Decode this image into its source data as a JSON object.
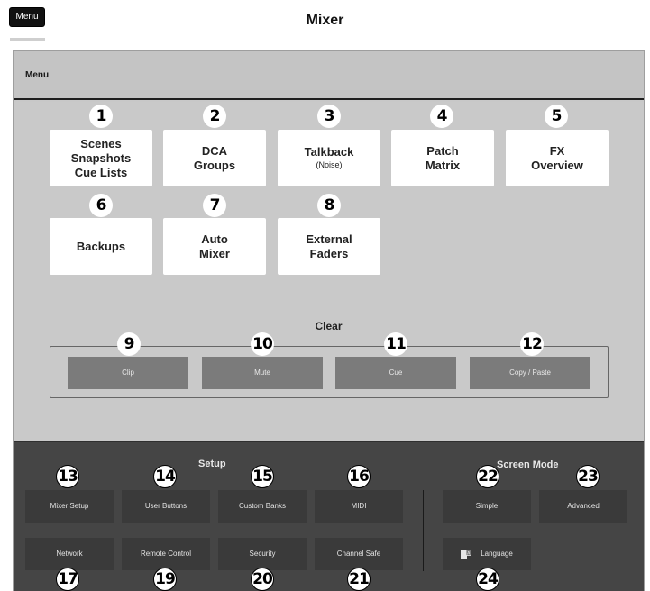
{
  "header": {
    "menu_badge": "Menu",
    "title": "Mixer"
  },
  "window": {
    "title": "Menu"
  },
  "menu_tiles": [
    {
      "num": "1",
      "lines": [
        "Scenes",
        "Snapshots",
        "Cue Lists"
      ],
      "sub": ""
    },
    {
      "num": "2",
      "lines": [
        "DCA",
        "Groups"
      ],
      "sub": ""
    },
    {
      "num": "3",
      "lines": [
        "Talkback"
      ],
      "sub": "(Noise)"
    },
    {
      "num": "4",
      "lines": [
        "Patch",
        "Matrix"
      ],
      "sub": ""
    },
    {
      "num": "5",
      "lines": [
        "FX",
        "Overview"
      ],
      "sub": ""
    },
    {
      "num": "6",
      "lines": [
        "Backups"
      ],
      "sub": ""
    },
    {
      "num": "7",
      "lines": [
        "Auto",
        "Mixer"
      ],
      "sub": ""
    },
    {
      "num": "8",
      "lines": [
        "External",
        "Faders"
      ],
      "sub": ""
    }
  ],
  "clear": {
    "label": "Clear",
    "buttons": [
      {
        "num": "9",
        "label": "Clip"
      },
      {
        "num": "10",
        "label": "Mute"
      },
      {
        "num": "11",
        "label": "Cue"
      },
      {
        "num": "12",
        "label": "Copy / Paste"
      }
    ]
  },
  "setup": {
    "label": "Setup",
    "buttons": [
      {
        "num": "13",
        "label": "Mixer Setup"
      },
      {
        "num": "14",
        "label": "User Buttons"
      },
      {
        "num": "15",
        "label": "Custom Banks"
      },
      {
        "num": "16",
        "label": "MIDI"
      },
      {
        "num": "17",
        "label": "Network"
      },
      {
        "num": "19",
        "label": "Remote Control"
      },
      {
        "num": "20",
        "label": "Security"
      },
      {
        "num": "21",
        "label": "Channel Safe"
      }
    ]
  },
  "screen_mode": {
    "label": "Screen Mode",
    "buttons": [
      {
        "num": "22",
        "label": "Simple"
      },
      {
        "num": "23",
        "label": "Advanced"
      },
      {
        "num": "24",
        "label": "Language",
        "icon": "language-icon"
      }
    ]
  },
  "colors": {
    "menu_bg": "#c9c9c9",
    "tile_bg": "#ffffff",
    "clear_btn_bg": "#7b7b7b",
    "setup_bg": "#454545",
    "setup_btn_bg": "#3a3a3a"
  }
}
